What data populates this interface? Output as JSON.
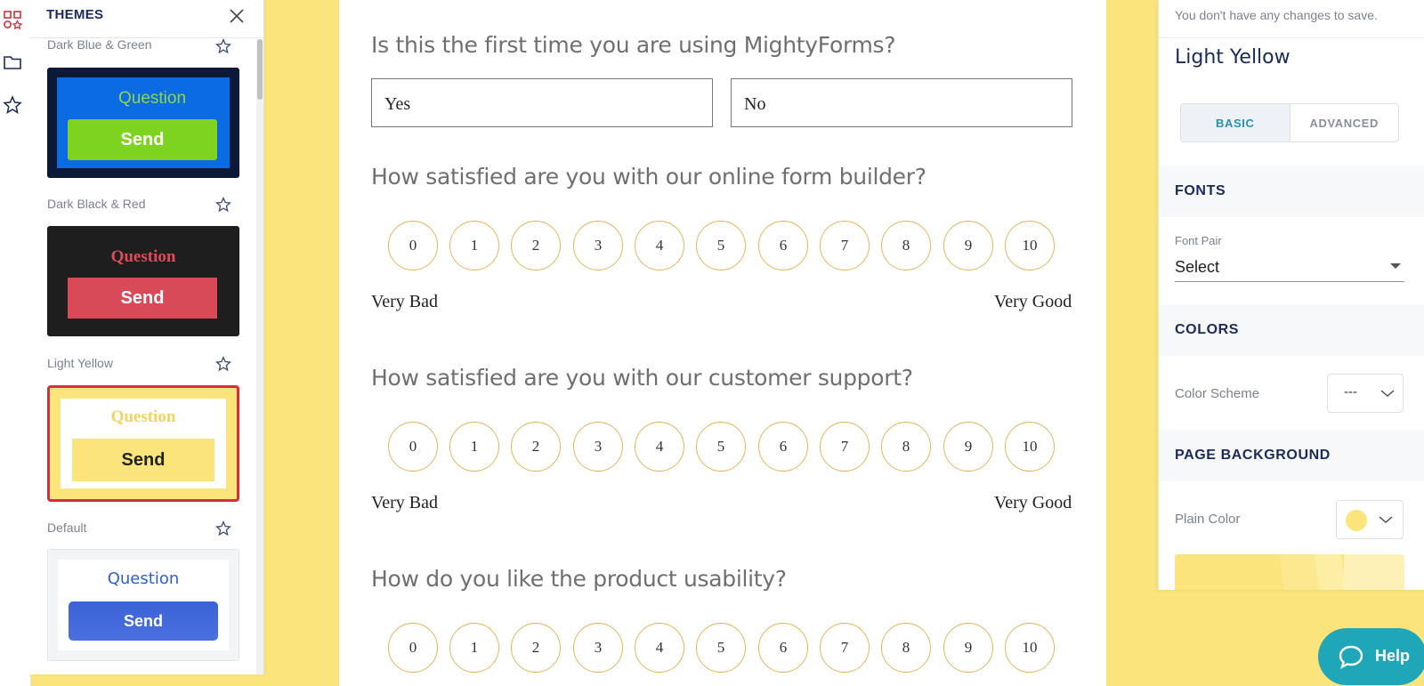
{
  "themes_panel": {
    "title": "THEMES",
    "themes": [
      {
        "name": "Dark Blue & Green",
        "question": "Question",
        "send": "Send",
        "colors": {
          "frame": "#0c1a3a",
          "bg": "#0a6be3",
          "question": "#8fd44a",
          "button": "#7ed321",
          "button_text": "#ffffff"
        }
      },
      {
        "name": "Dark Black & Red",
        "question": "Question",
        "send": "Send",
        "colors": {
          "frame": "#1e1e1e",
          "bg": "#1e1e1e",
          "question": "#e04b5a",
          "button": "#d94a58",
          "button_text": "#ffffff"
        }
      },
      {
        "name": "Light Yellow",
        "question": "Question",
        "send": "Send",
        "selected": true,
        "colors": {
          "frame": "#fbe47b",
          "bg": "#ffffff",
          "question": "#f4d35e",
          "button": "#fbe47b",
          "button_text": "#222222",
          "border": "#d62f3b"
        }
      },
      {
        "name": "Default",
        "question": "Question",
        "send": "Send",
        "colors": {
          "frame": "#f3f4f6",
          "bg": "#ffffff",
          "question": "#2f5fd1",
          "button": "#3b63d6",
          "button_text": "#ffffff"
        }
      }
    ]
  },
  "form": {
    "questions": [
      {
        "title": "Is this the first time you are using MightyForms?",
        "options": [
          "Yes",
          "No"
        ]
      },
      {
        "title": "How satisfied are you with our online form builder?",
        "scale": [
          "0",
          "1",
          "2",
          "3",
          "4",
          "5",
          "6",
          "7",
          "8",
          "9",
          "10"
        ],
        "low": "Very Bad",
        "high": "Very Good"
      },
      {
        "title": "How satisfied are you with our customer support?",
        "scale": [
          "0",
          "1",
          "2",
          "3",
          "4",
          "5",
          "6",
          "7",
          "8",
          "9",
          "10"
        ],
        "low": "Very Bad",
        "high": "Very Good"
      },
      {
        "title": "How do you like the product usability?",
        "scale": [
          "0",
          "1",
          "2",
          "3",
          "4",
          "5",
          "6",
          "7",
          "8",
          "9",
          "10"
        ]
      }
    ]
  },
  "settings_panel": {
    "save_message": "You don't have any changes to save.",
    "theme_name": "Light Yellow",
    "tabs": {
      "basic": "BASIC",
      "advanced": "ADVANCED"
    },
    "fonts": {
      "title": "FONTS",
      "font_pair_label": "Font Pair",
      "font_pair_value": "Select"
    },
    "colors": {
      "title": "COLORS",
      "color_scheme_label": "Color Scheme",
      "color_scheme_value": "---"
    },
    "page_background": {
      "title": "PAGE BACKGROUND",
      "plain_color_label": "Plain Color",
      "plain_color": "#fbe47b"
    }
  },
  "help": {
    "label": "Help"
  },
  "icons": [
    "apps-icon",
    "folder-icon",
    "star-icon",
    "close-icon",
    "chevron-down-icon",
    "chat-bubble-icon"
  ]
}
